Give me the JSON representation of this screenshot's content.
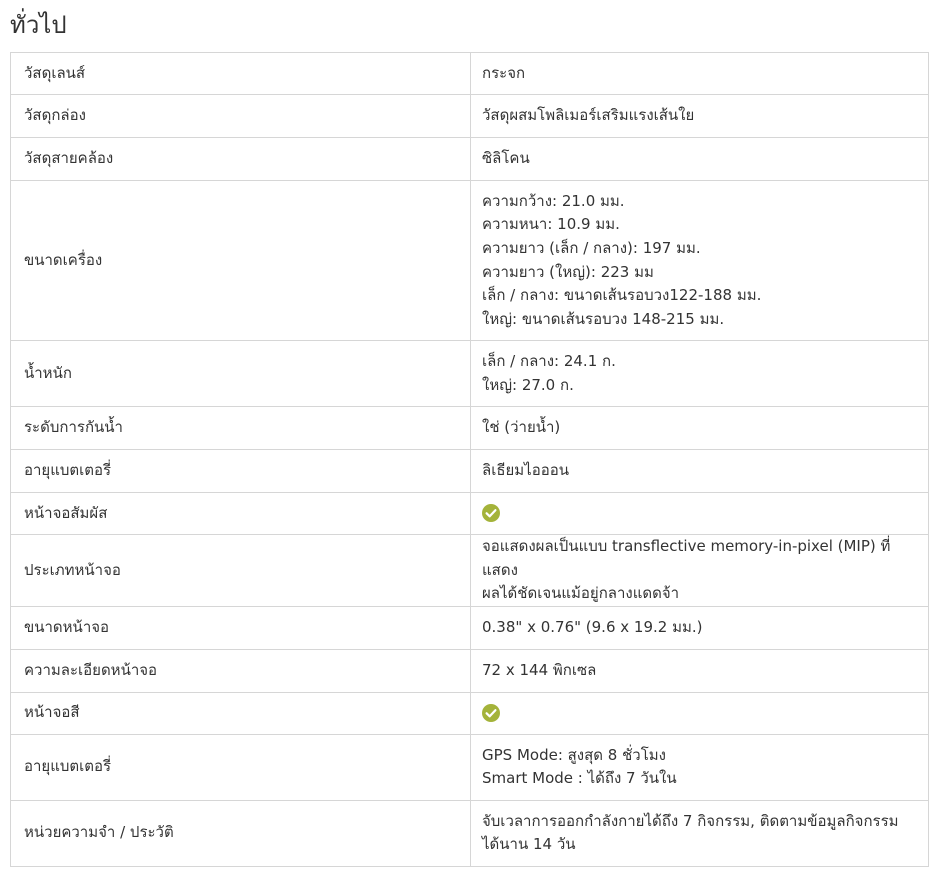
{
  "section": {
    "title": "ทั่วไป"
  },
  "rows": [
    {
      "label": "วัสดุเลนส์",
      "lines": [
        "กระจก"
      ]
    },
    {
      "label": "วัสดุกล่อง",
      "lines": [
        "วัสดุผสมโพลิเมอร์เสริมแรงเส้นใย"
      ]
    },
    {
      "label": "วัสดุสายคล้อง",
      "lines": [
        "ซิลิโคน"
      ]
    },
    {
      "label": "ขนาดเครื่อง",
      "lines": [
        "ความกว้าง: 21.0 มม.",
        "ความหนา: 10.9 มม.",
        "ความยาว (เล็ก / กลาง): 197 มม.",
        "ความยาว (ใหญ่): 223 มม",
        "เล็ก / กลาง: ขนาดเส้นรอบวง122-188 มม.",
        "ใหญ่: ขนาดเส้นรอบวง 148-215 มม."
      ]
    },
    {
      "label": "น้ำหนัก",
      "lines": [
        "เล็ก / กลาง: 24.1 ก.",
        "ใหญ่: 27.0 ก."
      ]
    },
    {
      "label": "ระดับการกันน้ำ",
      "lines": [
        "ใช่ (ว่ายน้ำ)"
      ]
    },
    {
      "label": "อายุแบตเตอรี่",
      "lines": [
        "ลิเธียมไอออน"
      ]
    },
    {
      "label": "หน้าจอสัมผัส",
      "check": true,
      "icon": "check-circle-icon"
    },
    {
      "label": "ประเภทหน้าจอ",
      "lines": [
        "จอแสดงผลเป็นแบบ transflective memory-in-pixel (MIP) ที่แสดง",
        "ผลได้ชัดเจนแม้อยู่กลางแดดจ้า"
      ]
    },
    {
      "label": "ขนาดหน้าจอ",
      "lines": [
        "0.38\" x 0.76\" (9.6 x 19.2 มม.)"
      ]
    },
    {
      "label": "ความละเอียดหน้าจอ",
      "lines": [
        "72 x 144  พิกเซล"
      ]
    },
    {
      "label": "หน้าจอสี",
      "check": true,
      "icon": "check-circle-icon"
    },
    {
      "label": "อายุแบตเตอรี่",
      "lines": [
        "GPS Mode: สูงสุด 8 ชั่วโมง",
        "Smart Mode : ได้ถึง 7 วันใน"
      ]
    },
    {
      "label": "หน่วยความจำ / ประวัติ",
      "lines": [
        "จับเวลาการออกกำลังกายได้ถึง 7 กิจกรรม, ติดตามข้อมูลกิจกรรม",
        "ได้นาน 14 วัน"
      ]
    }
  ],
  "colors": {
    "check": "#a4b33a",
    "border": "#d6d6d6",
    "text": "#333333"
  }
}
